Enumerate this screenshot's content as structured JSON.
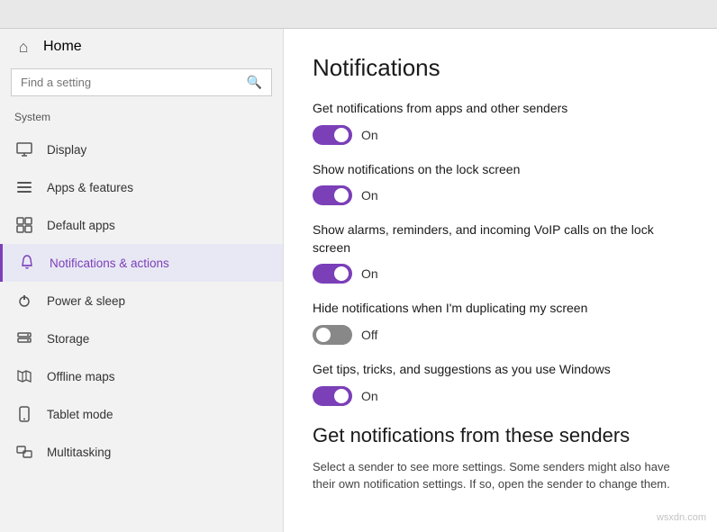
{
  "topbar": {},
  "sidebar": {
    "home_label": "Home",
    "search_placeholder": "Find a setting",
    "system_label": "System",
    "nav_items": [
      {
        "id": "display",
        "label": "Display",
        "icon": "🖥"
      },
      {
        "id": "apps",
        "label": "Apps & features",
        "icon": "☰"
      },
      {
        "id": "default-apps",
        "label": "Default apps",
        "icon": "⊞"
      },
      {
        "id": "notifications",
        "label": "Notifications & actions",
        "icon": "💬",
        "active": true
      },
      {
        "id": "power",
        "label": "Power & sleep",
        "icon": "⏻"
      },
      {
        "id": "storage",
        "label": "Storage",
        "icon": "🗄"
      },
      {
        "id": "offline-maps",
        "label": "Offline maps",
        "icon": "🗺"
      },
      {
        "id": "tablet-mode",
        "label": "Tablet mode",
        "icon": "📱"
      },
      {
        "id": "multitasking",
        "label": "Multitasking",
        "icon": "⧉"
      }
    ]
  },
  "content": {
    "title": "Notifications",
    "settings": [
      {
        "id": "notif-from-apps",
        "label": "Get notifications from apps and other senders",
        "state": "on",
        "state_label": "On"
      },
      {
        "id": "notif-lock-screen",
        "label": "Show notifications on the lock screen",
        "state": "on",
        "state_label": "On"
      },
      {
        "id": "notif-alarms",
        "label": "Show alarms, reminders, and incoming VoIP calls on the lock screen",
        "state": "on",
        "state_label": "On"
      },
      {
        "id": "notif-hide-duplicating",
        "label": "Hide notifications when I'm duplicating my screen",
        "state": "off",
        "state_label": "Off"
      },
      {
        "id": "notif-tips",
        "label": "Get tips, tricks, and suggestions as you use Windows",
        "state": "on",
        "state_label": "On"
      }
    ],
    "senders_title": "Get notifications from these senders",
    "senders_description": "Select a sender to see more settings. Some senders might also have their own notification settings. If so, open the sender to change them."
  },
  "watermark": "wsxdn.com"
}
